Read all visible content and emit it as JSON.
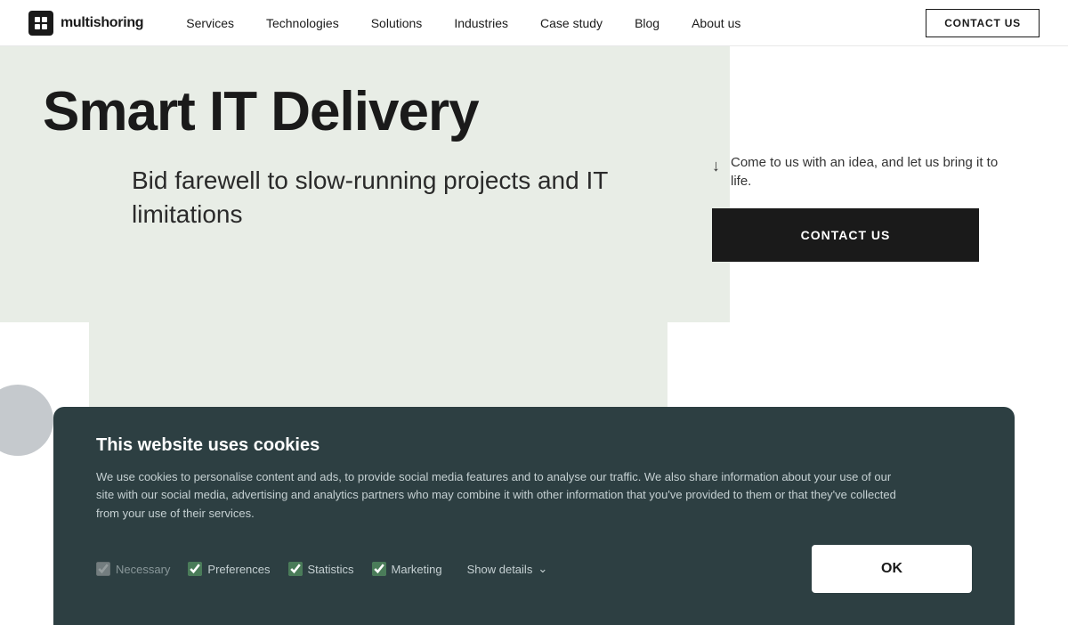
{
  "logo": {
    "name": "multishoring",
    "icon_label": "ms-logo"
  },
  "nav": {
    "links": [
      {
        "label": "Services",
        "id": "services"
      },
      {
        "label": "Technologies",
        "id": "technologies"
      },
      {
        "label": "Solutions",
        "id": "solutions"
      },
      {
        "label": "Industries",
        "id": "industries"
      },
      {
        "label": "Case study",
        "id": "case-study"
      },
      {
        "label": "Blog",
        "id": "blog"
      },
      {
        "label": "About us",
        "id": "about-us"
      }
    ],
    "cta_label": "CONTACT US"
  },
  "hero": {
    "title": "Smart IT Delivery",
    "subtitle": "Bid farewell to slow-running projects and IT limitations",
    "tagline": "Come to us with an idea, and let us bring it to life.",
    "contact_button_label": "CONTACT US",
    "arrow_symbol": "↓"
  },
  "cookie_banner": {
    "title": "This website uses cookies",
    "text": "We use cookies to personalise content and ads, to provide social media features and to analyse our traffic. We also share information about your use of our site with our social media, advertising and analytics partners who may combine it with other information that you've provided to them or that they've collected from your use of their services.",
    "checkboxes": [
      {
        "label": "Necessary",
        "checked": true,
        "disabled": true
      },
      {
        "label": "Preferences",
        "checked": true,
        "disabled": false
      },
      {
        "label": "Statistics",
        "checked": true,
        "disabled": false
      },
      {
        "label": "Marketing",
        "checked": true,
        "disabled": false
      }
    ],
    "show_details_label": "Show details",
    "ok_label": "OK"
  }
}
